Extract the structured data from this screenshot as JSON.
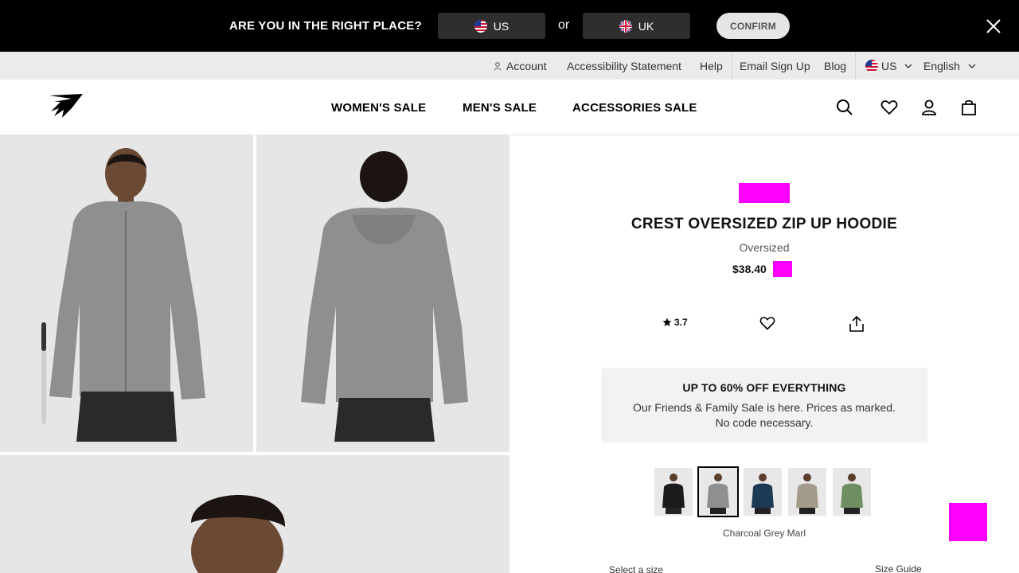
{
  "region_banner": {
    "question": "ARE YOU IN THE RIGHT PLACE?",
    "us_label": "US",
    "or_label": "or",
    "uk_label": "UK",
    "confirm_label": "CONFIRM",
    "close_icon": "close-icon"
  },
  "utility": {
    "account": "Account",
    "accessibility": "Accessibility Statement",
    "help": "Help",
    "email_signup": "Email Sign Up",
    "blog": "Blog",
    "region": "US",
    "language": "English"
  },
  "nav": {
    "links": [
      "WOMEN'S SALE",
      "MEN'S SALE",
      "ACCESSORIES SALE"
    ],
    "icons": [
      "search-icon",
      "heart-icon",
      "user-icon",
      "bag-icon"
    ]
  },
  "product": {
    "title": "CREST OVERSIZED ZIP UP HOODIE",
    "fit": "Oversized",
    "price": "$38.40",
    "rating": "3.7",
    "promo": {
      "title": "UP TO 60% OFF EVERYTHING",
      "line1": "Our Friends & Family Sale is here. Prices as marked.",
      "line2": "No code necessary."
    },
    "selected_colour": "Charcoal Grey Marl",
    "size_prompt": "Select a size",
    "size_guide": "Size Guide"
  },
  "colors": {
    "banner_bg": "#000000",
    "utility_bg": "#ebebeb",
    "placeholder": "#ff00ff",
    "promo_bg": "#f2f2f2"
  }
}
